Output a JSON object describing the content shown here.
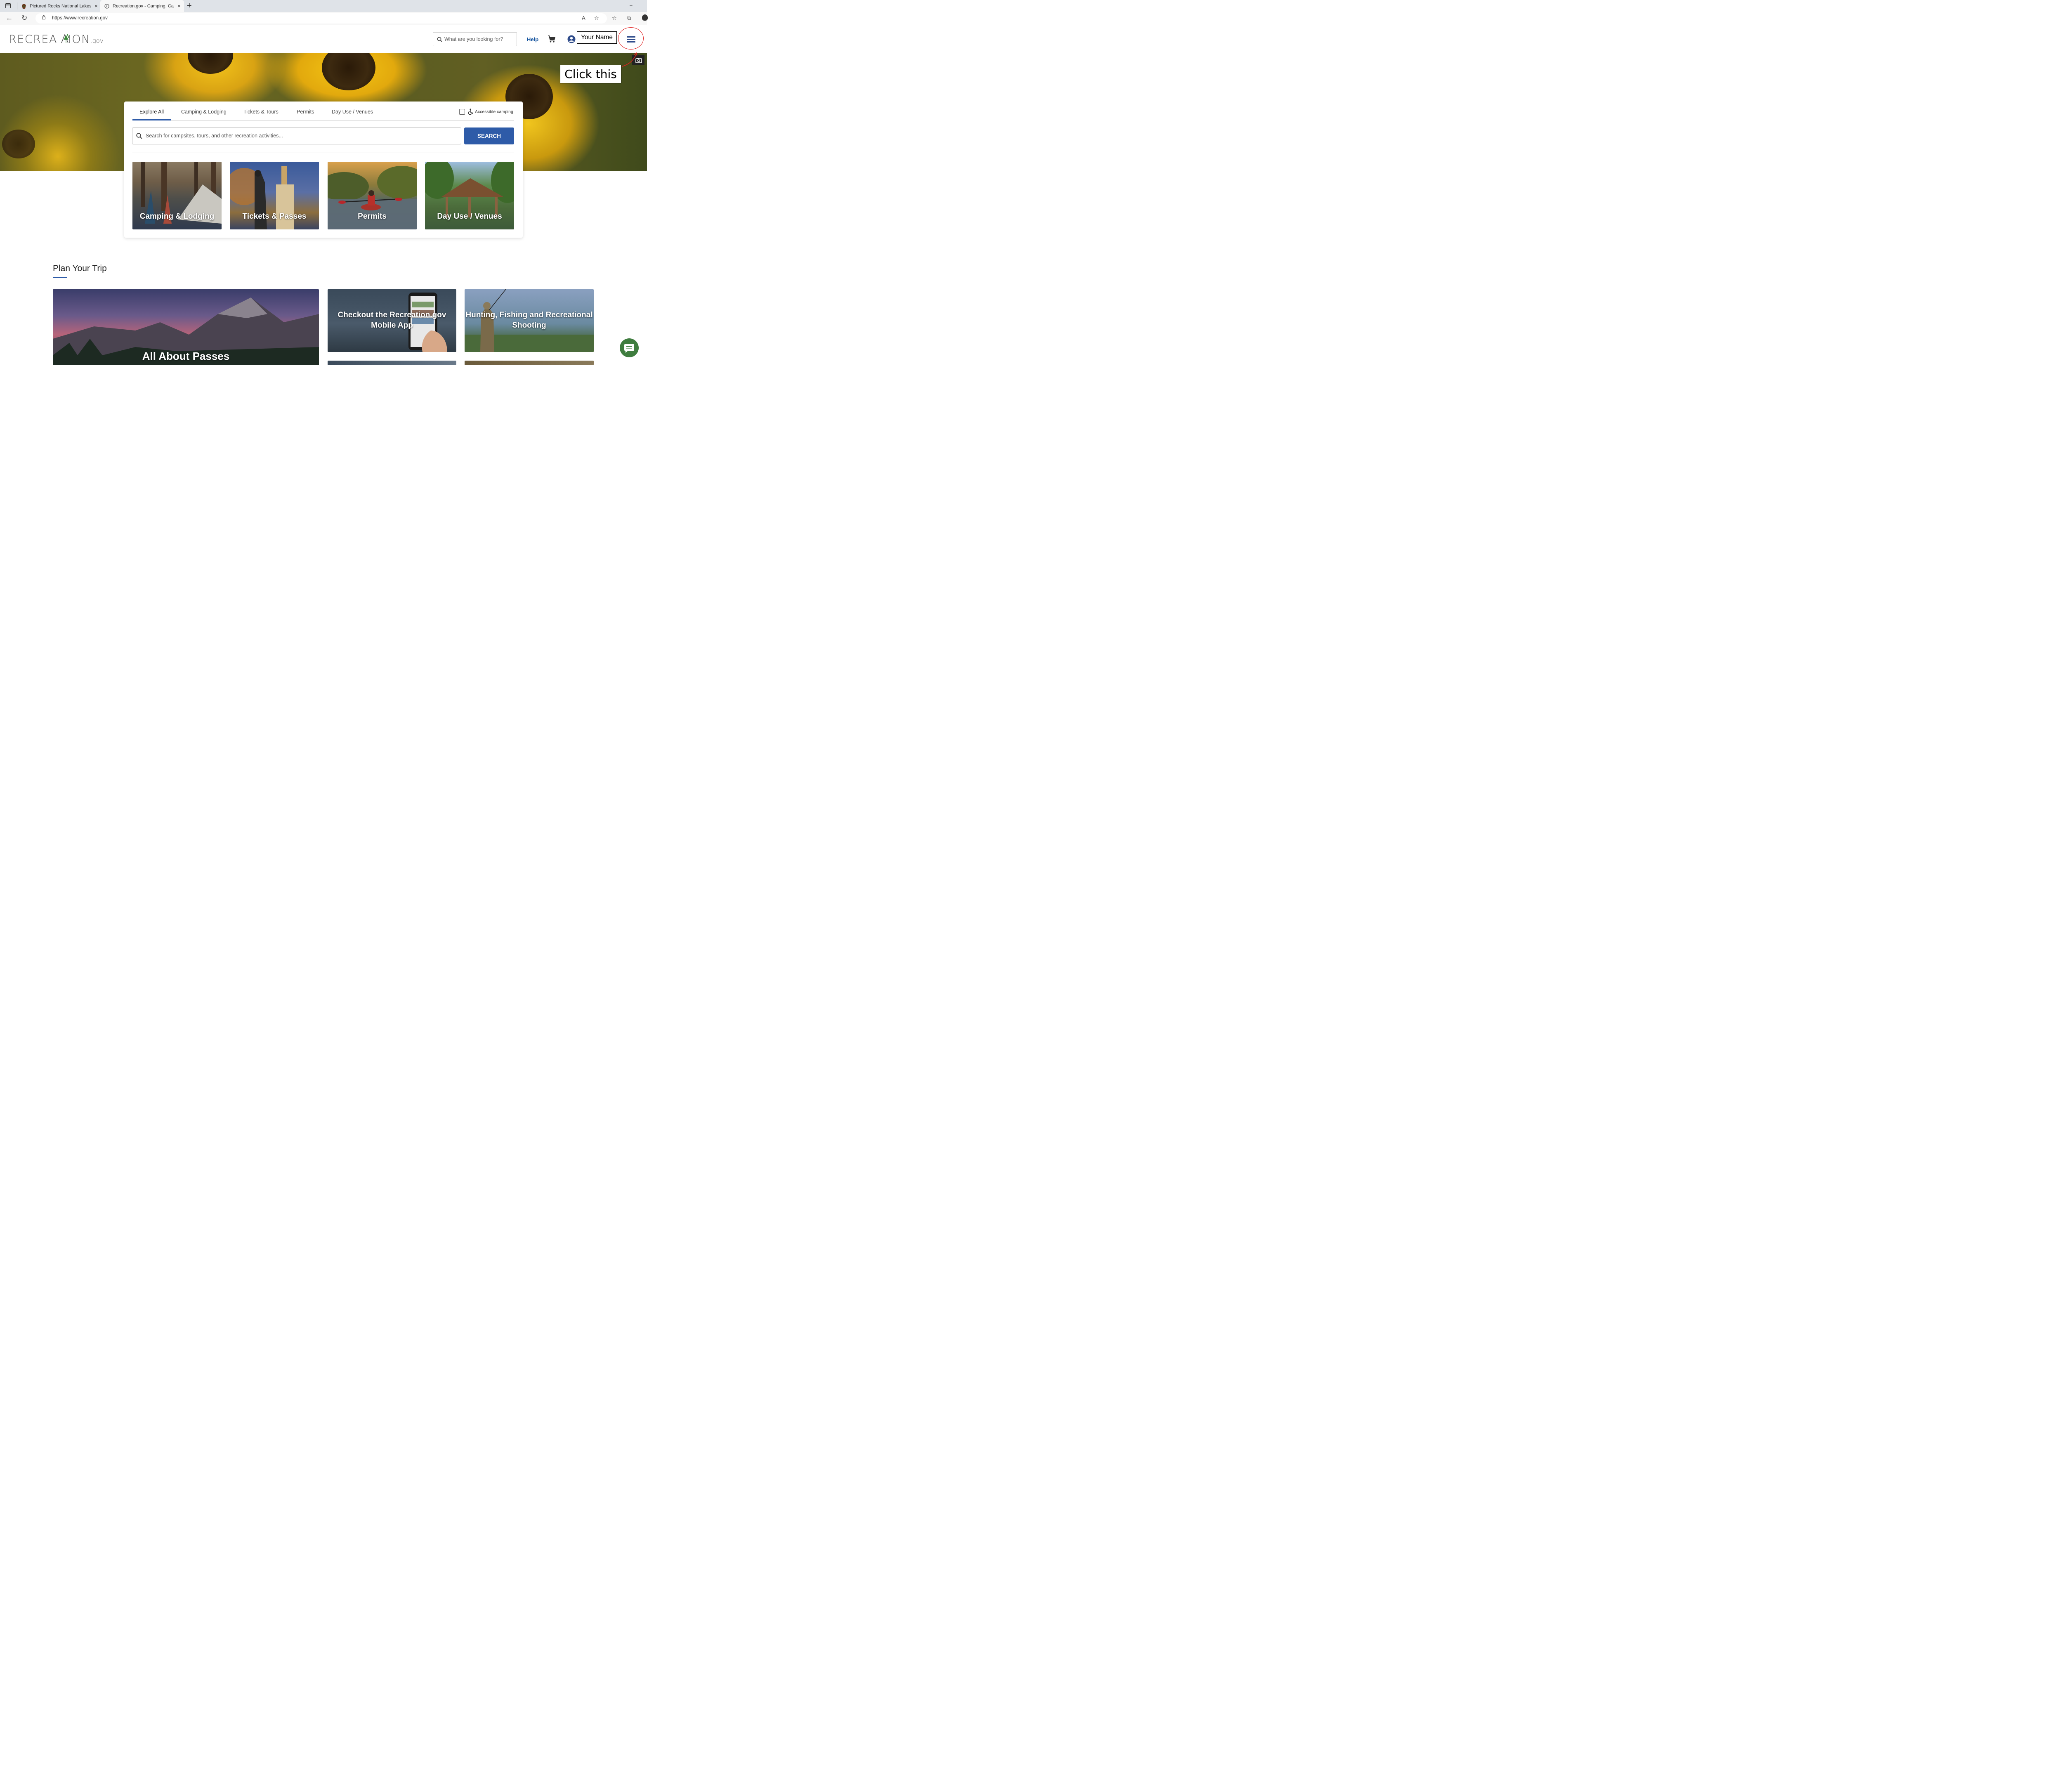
{
  "browser": {
    "tabs": [
      {
        "title": "Pictured Rocks National Lakesho",
        "close": "×"
      },
      {
        "title": "Recreation.gov - Camping, Cabin",
        "close": "×"
      }
    ],
    "new_tab": "+",
    "minimize": "–",
    "url": "https://www.recreation.gov"
  },
  "header": {
    "logo_main": "RECREA",
    "logo_tail": "ION",
    "logo_gov": ".gov",
    "search_placeholder": "What are you looking for?",
    "help": "Help",
    "user_name": "Your Name"
  },
  "annotation": {
    "callout": "Click this",
    "highlight_color": "#e02020"
  },
  "search_card": {
    "tabs": [
      "Explore All",
      "Camping & Lodging",
      "Tickets & Tours",
      "Permits",
      "Day Use / Venues"
    ],
    "active_tab": "Explore All",
    "accessible": "Accessible camping",
    "search_placeholder": "Search for campsites, tours, and other recreation activities...",
    "search_button": "SEARCH",
    "categories": [
      "Camping & Lodging",
      "Tickets & Passes",
      "Permits",
      "Day Use / Venues"
    ]
  },
  "plan": {
    "title": "Plan Your Trip",
    "tiles": [
      "All About Passes",
      "Checkout the Recreation.gov Mobile App",
      "Hunting, Fishing and Recreational Shooting"
    ]
  },
  "colors": {
    "accent": "#2e5ba8",
    "link": "#0e4f9c",
    "chat": "#3f7d3f"
  }
}
